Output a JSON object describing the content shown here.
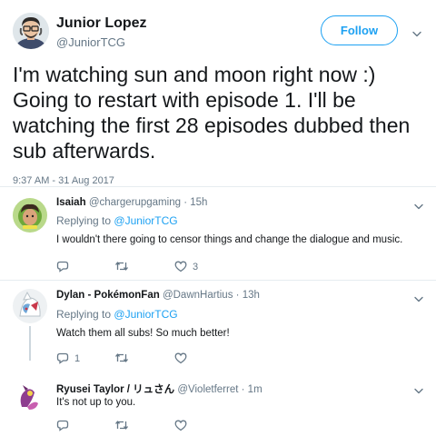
{
  "main": {
    "author_name": "Junior Lopez",
    "author_handle": "@JuniorTCG",
    "follow_label": "Follow",
    "text": "I'm watching sun and moon right now :) Going to restart with episode 1. I'll be watching the first 28 episodes dubbed then sub afterwards.",
    "timestamp": "9:37 AM - 31 Aug 2017"
  },
  "replies": [
    {
      "name": "Isaiah",
      "handle": "@chargerupgaming",
      "time": "15h",
      "replying_prefix": "Replying to",
      "replying_to": "@JuniorTCG",
      "text": "I wouldn't there going to censor things and change the dialogue and music.",
      "reply_count": "",
      "retweet_count": "",
      "like_count": "3"
    },
    {
      "name": "Dylan - PokémonFan",
      "handle": "@DawnHartius",
      "time": "13h",
      "replying_prefix": "Replying to",
      "replying_to": "@JuniorTCG",
      "text": "Watch them all subs! So much better!",
      "reply_count": "1",
      "retweet_count": "",
      "like_count": ""
    },
    {
      "name": "Ryusei Taylor / リュさん",
      "handle": "@Violetferret",
      "time": "1m",
      "text": "It's not up to you.",
      "reply_count": "",
      "retweet_count": "",
      "like_count": ""
    }
  ],
  "icons": {
    "reply": "reply-icon",
    "retweet": "retweet-icon",
    "like": "heart-icon",
    "caret": "chevron-down-icon"
  },
  "colors": {
    "accent": "#1da1f2",
    "muted": "#657786",
    "text": "#14171a",
    "divider": "#e6ecf0"
  }
}
